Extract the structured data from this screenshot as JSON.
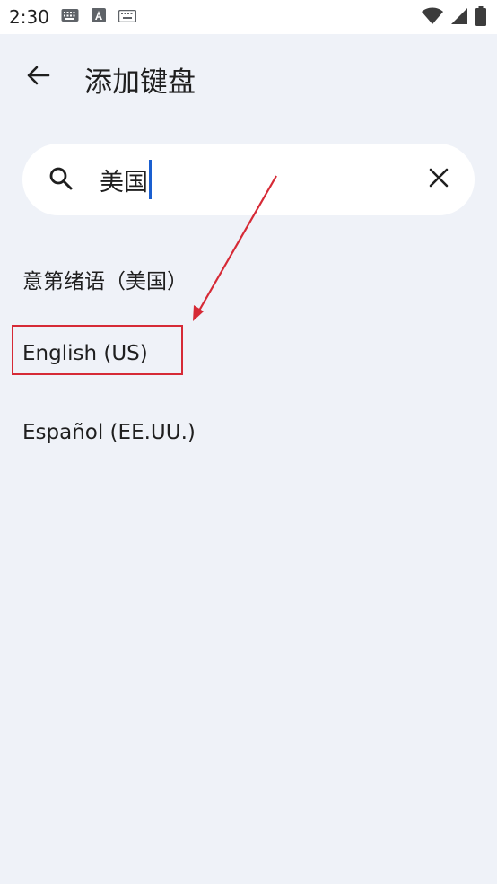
{
  "status_bar": {
    "time": "2:30",
    "left_icons": [
      "keyboard-icon",
      "a-icon",
      "keyboard-small-icon"
    ],
    "right_icons": [
      "wifi-icon",
      "signal-icon",
      "battery-icon"
    ]
  },
  "app_bar": {
    "title": "添加键盘",
    "back_icon": "arrow-left-icon"
  },
  "search": {
    "value": "美国",
    "clear_icon": "close-icon",
    "search_icon": "search-icon"
  },
  "results": [
    {
      "label": "意第绪语（美国）"
    },
    {
      "label": "English (US)"
    },
    {
      "label": "Español (EE.UU.)"
    }
  ],
  "colors": {
    "background": "#eff2f8",
    "annotation": "#d62a36",
    "cursor": "#1a5fd0"
  }
}
